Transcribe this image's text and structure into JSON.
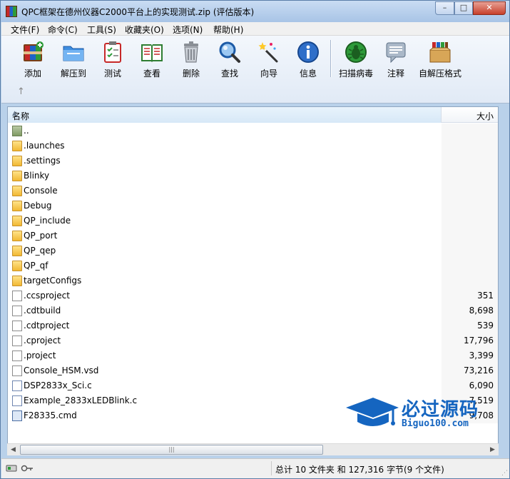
{
  "window": {
    "title": "QPC框架在德州仪器C2000平台上的实现测试.zip (评估版本)",
    "min_glyph": "–",
    "max_glyph": "□",
    "close_glyph": "✕"
  },
  "menu": [
    "文件(F)",
    "命令(C)",
    "工具(S)",
    "收藏夹(O)",
    "选项(N)",
    "帮助(H)"
  ],
  "toolbar": {
    "buttons": [
      {
        "label": "添加",
        "icon": "add-archive-icon"
      },
      {
        "label": "解压到",
        "icon": "extract-folder-icon"
      },
      {
        "label": "测试",
        "icon": "test-checklist-icon"
      },
      {
        "label": "查看",
        "icon": "view-book-icon"
      },
      {
        "label": "删除",
        "icon": "trash-icon"
      },
      {
        "label": "查找",
        "icon": "magnifier-icon"
      },
      {
        "label": "向导",
        "icon": "wizard-wand-icon"
      },
      {
        "label": "信息",
        "icon": "info-icon"
      },
      {
        "label": "扫描病毒",
        "icon": "virus-scan-icon"
      },
      {
        "label": "注释",
        "icon": "comment-icon"
      },
      {
        "label": "自解压格式",
        "icon": "sfx-box-icon"
      }
    ],
    "up_glyph": "↑"
  },
  "list": {
    "col_name": "名称",
    "col_size": "大小",
    "sort_glyph": "▲",
    "rows": [
      {
        "name": "..",
        "size": "",
        "type": "up"
      },
      {
        "name": ".launches",
        "size": "",
        "type": "folder"
      },
      {
        "name": ".settings",
        "size": "",
        "type": "folder"
      },
      {
        "name": "Blinky",
        "size": "",
        "type": "folder"
      },
      {
        "name": "Console",
        "size": "",
        "type": "folder"
      },
      {
        "name": "Debug",
        "size": "",
        "type": "folder"
      },
      {
        "name": "QP_include",
        "size": "",
        "type": "folder"
      },
      {
        "name": "QP_port",
        "size": "",
        "type": "folder"
      },
      {
        "name": "QP_qep",
        "size": "",
        "type": "folder"
      },
      {
        "name": "QP_qf",
        "size": "",
        "type": "folder"
      },
      {
        "name": "targetConfigs",
        "size": "",
        "type": "folder"
      },
      {
        "name": ".ccsproject",
        "size": "351",
        "type": "file"
      },
      {
        "name": ".cdtbuild",
        "size": "8,698",
        "type": "file"
      },
      {
        "name": ".cdtproject",
        "size": "539",
        "type": "file"
      },
      {
        "name": ".cproject",
        "size": "17,796",
        "type": "file"
      },
      {
        "name": ".project",
        "size": "3,399",
        "type": "file"
      },
      {
        "name": "Console_HSM.vsd",
        "size": "73,216",
        "type": "file"
      },
      {
        "name": "DSP2833x_Sci.c",
        "size": "6,090",
        "type": "c"
      },
      {
        "name": "Example_2833xLEDBlink.c",
        "size": "7,519",
        "type": "c"
      },
      {
        "name": "F28335.cmd",
        "size": "9,708",
        "type": "cmd"
      }
    ]
  },
  "scrollbar": {
    "left_glyph": "◀",
    "right_glyph": "▶",
    "thumb_glyph": "|||"
  },
  "status": {
    "text": "总计 10 文件夹 和 127,316 字节(9 个文件)"
  },
  "watermark": {
    "cn": "必过源码",
    "en": "Biguo100.com"
  }
}
